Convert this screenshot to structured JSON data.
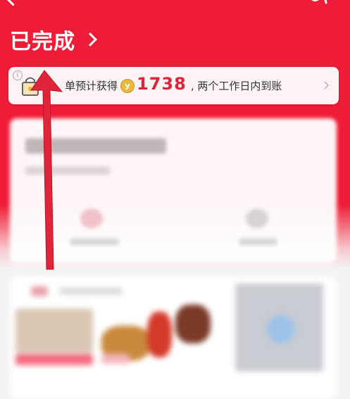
{
  "header": {
    "status_label": "已完成"
  },
  "banner": {
    "text_before": "单预计获得",
    "amount": "1738",
    "text_after": ", 两个工作日内到账",
    "info_glyph": "i",
    "coin_glyph": "y"
  },
  "colors": {
    "header_red": "#ee1c36",
    "amount_red": "#d8263a",
    "arrow_red": "#e0243a",
    "coin_gold": "#e9b83c"
  },
  "icons": {
    "back": "chevron-left-icon",
    "brand": "brand-logo-icon",
    "status_chevron": "chevron-right-icon",
    "info": "info-icon",
    "bag": "shopping-bag-icon",
    "coin": "coin-icon",
    "banner_chevron": "chevron-right-icon"
  }
}
